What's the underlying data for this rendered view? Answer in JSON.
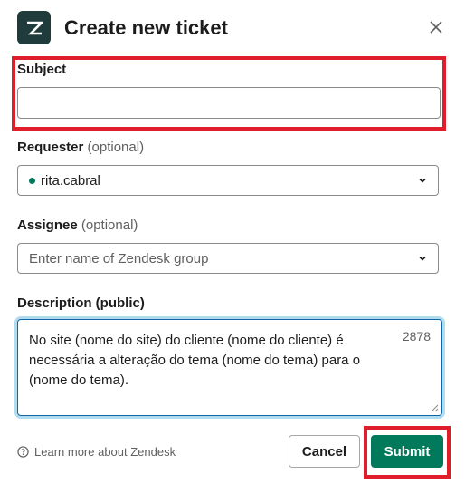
{
  "header": {
    "title": "Create new ticket",
    "logo_icon": "zendesk-logo",
    "close_icon": "close-icon"
  },
  "subject": {
    "label": "Subject",
    "value": ""
  },
  "requester": {
    "label": "Requester",
    "optional": "(optional)",
    "value": "rita.cabral",
    "status_color": "#007a5a"
  },
  "assignee": {
    "label": "Assignee",
    "optional": "(optional)",
    "placeholder": "Enter name of Zendesk group"
  },
  "description": {
    "label": "Description (public)",
    "value": "No site (nome do site) do cliente (nome do cliente) é necessária a alteração do tema (nome do tema) para o (nome do tema).",
    "counter": "2878"
  },
  "footer": {
    "learn_more": "Learn more about Zendesk",
    "cancel_label": "Cancel",
    "submit_label": "Submit"
  },
  "colors": {
    "accent": "#007a5a",
    "highlight": "#e01e2b",
    "focus": "#1264a3"
  }
}
